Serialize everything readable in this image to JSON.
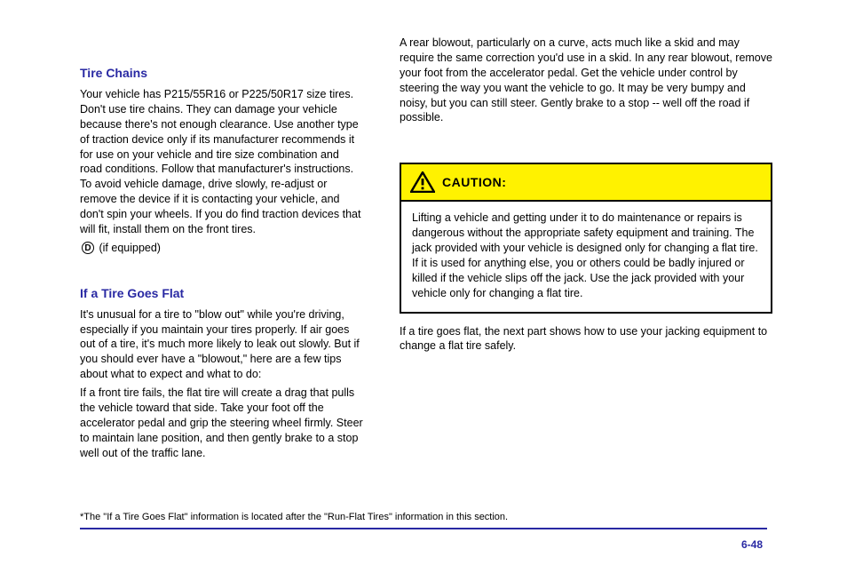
{
  "left": {
    "heading": "Tire Chains",
    "paragraph": "Your vehicle has P215/55R16 or P225/50R17 size tires. Don't use tire chains. They can damage your vehicle because there's not enough clearance. Use another type of traction device only if its manufacturer recommends it for use on your vehicle and tire size combination and road conditions. Follow that manufacturer's instructions. To avoid vehicle damage, drive slowly, re-adjust or remove the device if it is contacting your vehicle, and don't spin your wheels. If you do find traction devices that will fit, install them on the front tires.",
    "option_line": "(if equipped)",
    "heading2": "If a Tire Goes Flat",
    "paragraph2": "It's unusual for a tire to \"blow out\" while you're driving, especially if you maintain your tires properly. If air goes out of a tire, it's much more likely to leak out slowly. But if you should ever have a \"blowout,\" here are a few tips about what to expect and what to do:",
    "paragraph3": "If a front tire fails, the flat tire will create a drag that pulls the vehicle toward that side. Take your foot off the accelerator pedal and grip the steering wheel firmly. Steer to maintain lane position, and then gently brake to a stop well out of the traffic lane."
  },
  "right": {
    "intro": "A rear blowout, particularly on a curve, acts much like a skid and may require the same correction you'd use in a skid. In any rear blowout, remove your foot from the accelerator pedal. Get the vehicle under control by steering the way you want the vehicle to go. It may be very bumpy and noisy, but you can still steer. Gently brake to a stop -- well off the road if possible.",
    "caution_label": "CAUTION:",
    "caution_body": "Lifting a vehicle and getting under it to do maintenance or repairs is dangerous without the appropriate safety equipment and training. The jack provided with your vehicle is designed only for changing a flat tire. If it is used for anything else, you or others could be badly injured or killed if the vehicle slips off the jack. Use the jack provided with your vehicle only for changing a flat tire.",
    "below1": "If a tire goes flat, the next part shows how to use your jacking equipment to change a flat tire safely."
  },
  "footnote": "*The \"If a Tire Goes Flat\" information is located after the \"Run-Flat Tires\" information in this section.",
  "page_number": "6-48"
}
